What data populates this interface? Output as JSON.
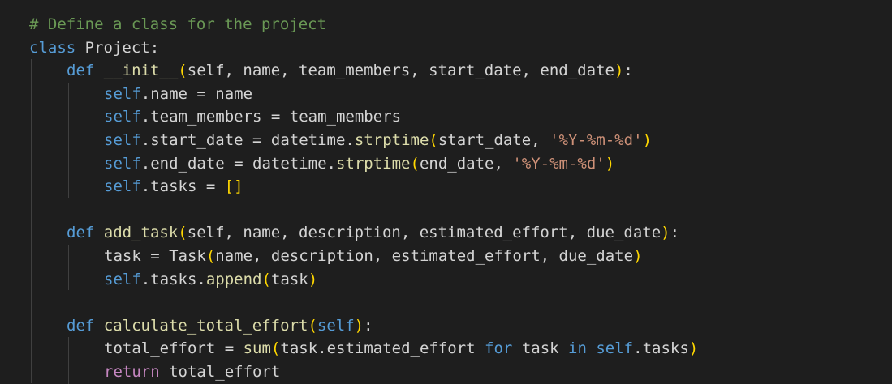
{
  "editor": {
    "language": "python",
    "theme_colors": {
      "background": "#1e1e1e",
      "keyword": "#569cd6",
      "function": "#dcdcaa",
      "string": "#ce9178",
      "comment": "#6a9955",
      "bracket": "#ffd700",
      "text": "#d4d4d4"
    },
    "lines": [
      "# Define a class for the project",
      "class Project:",
      "def __init__(self, name, team_members, start_date, end_date):",
      "self.name = name",
      "self.team_members = team_members",
      "self.start_date = datetime.strptime(start_date, '%Y-%m-%d')",
      "self.end_date = datetime.strptime(end_date, '%Y-%m-%d')",
      "self.tasks = []",
      "",
      "def add_task(self, name, description, estimated_effort, due_date):",
      "task = Task(name, description, estimated_effort, due_date)",
      "self.tasks.append(task)",
      "",
      "def calculate_total_effort(self):",
      "total_effort = sum(task.estimated_effort for task in self.tasks)",
      "return total_effort"
    ],
    "tokens": {
      "comment": "# Define a class for the project",
      "class_kw": "class",
      "class_name": "Project",
      "colon": ":",
      "def_kw": "def",
      "init_name": "__init__",
      "init_params": "self, name, team_members, start_date, end_date",
      "self": "self",
      "name_attr": ".name = name",
      "team_attr": ".team_members = team_members",
      "start_attr": ".start_date = datetime.",
      "end_attr": ".end_date = datetime.",
      "strptime": "strptime",
      "start_arg": "start_date, ",
      "end_arg": "end_date, ",
      "date_fmt": "'%Y-%m-%d'",
      "tasks_attr": ".tasks = ",
      "empty_list": "[]",
      "add_task_name": "add_task",
      "add_task_params": "self, name, description, estimated_effort, due_date",
      "task_assign": "task = ",
      "task_cls": "Task",
      "task_args": "name, description, estimated_effort, due_date",
      "tasks_append_prefix": ".tasks.",
      "append": "append",
      "append_arg": "task",
      "calc_name": "calculate_total_effort",
      "calc_params": "self",
      "total_assign": "total_effort = ",
      "sum": "sum",
      "sum_expr_a": "task.estimated_effort ",
      "for_kw": "for",
      "task_var": " task ",
      "in_kw": "in",
      "self_tasks": ".tasks",
      "return_kw": "return",
      "return_val": " total_effort"
    }
  }
}
